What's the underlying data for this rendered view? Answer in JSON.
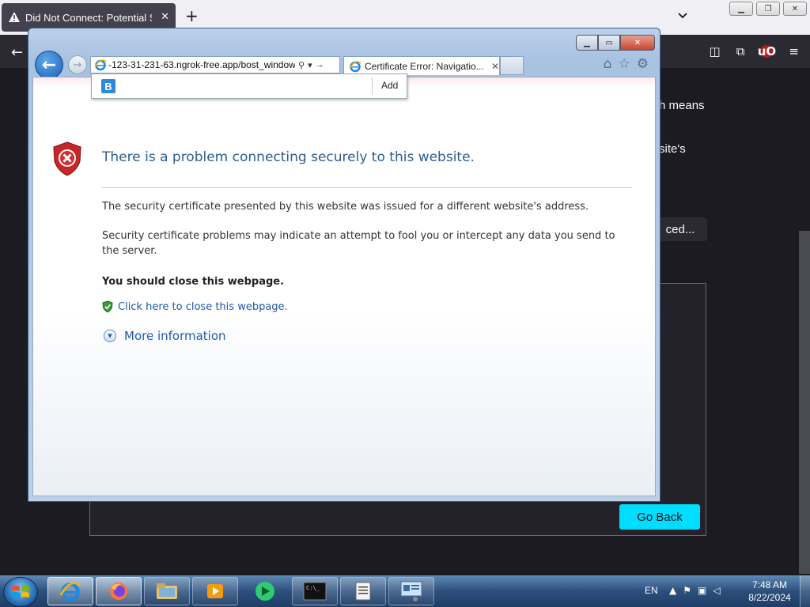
{
  "firefox": {
    "tab_title": "Did Not Connect: Potential Security Issue",
    "tab_close": "✕",
    "new_tab": "+",
    "content_fragment_1": "h means",
    "content_fragment_2": "site's",
    "advanced_fragment": "ced...",
    "go_back_label": "Go Back",
    "accent_color": "#00ddff"
  },
  "ie": {
    "address": "-123-31-231-63.ngrok-free.app/bost_window",
    "tab_title": "Certificate Error: Navigatio...",
    "suggest_add": "Add",
    "suggest_search_icon": "B",
    "error": {
      "title": "There is a problem connecting securely to this website.",
      "p1": "The security certificate presented by this website was issued for a different website's address.",
      "p2": "Security certificate problems may indicate an attempt to fool you or intercept any data you send to the server.",
      "strong": "You should close this webpage.",
      "close_link": "Click here to close this webpage.",
      "more_info": "More information"
    }
  },
  "taskbar": {
    "lang": "EN",
    "time": "7:48 AM",
    "date": "8/22/2024"
  }
}
